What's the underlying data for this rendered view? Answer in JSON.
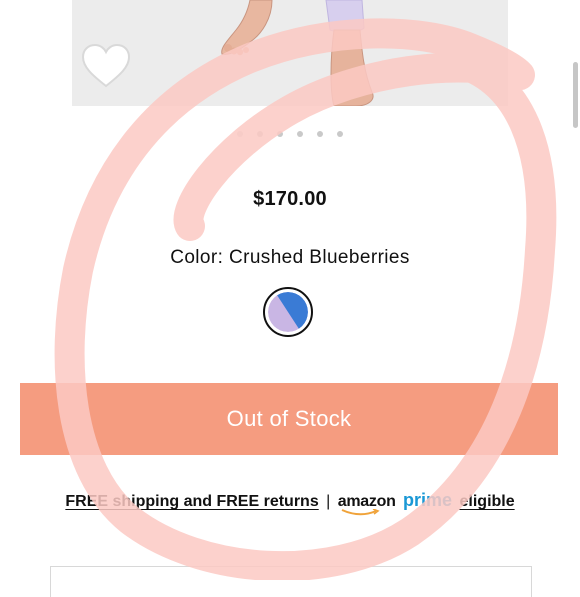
{
  "product": {
    "price": "$170.00",
    "color_label": "Color: Crushed Blueberries",
    "swatch_colors": [
      "#3a7bd5",
      "#c9b6e4"
    ],
    "image_count": 6,
    "active_image": 1
  },
  "cta": {
    "label": "Out of Stock",
    "color": "#f59c80"
  },
  "shipping": {
    "text": "FREE shipping and FREE returns",
    "separator": "|",
    "amazon": "amazon",
    "prime": "prime",
    "eligible": "eligible"
  },
  "icons": {
    "wishlist": "heart-icon"
  },
  "annotation": {
    "color": "#fbc9c3"
  }
}
